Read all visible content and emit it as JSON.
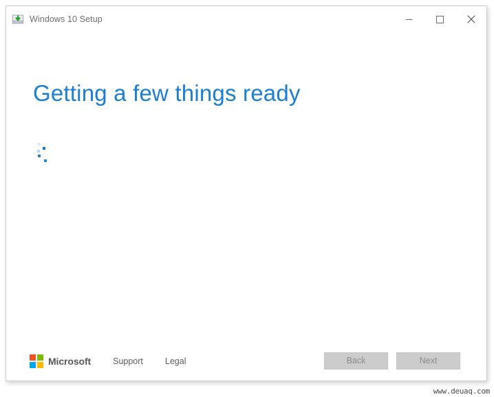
{
  "window": {
    "title": "Windows 10 Setup",
    "app_icon": "windows-setup-download-icon",
    "controls": {
      "minimize": "minimize-icon",
      "maximize": "maximize-icon",
      "close": "close-icon"
    }
  },
  "main": {
    "heading": "Getting a few things ready",
    "heading_color": "#1a7fd4",
    "spinner": {
      "name": "loading-spinner",
      "dot_color": "#1b79c8",
      "dot_count": 5
    }
  },
  "footer": {
    "brand": {
      "logo_name": "microsoft-logo",
      "wordmark": "Microsoft",
      "logo_colors": {
        "top_left": "#f25022",
        "top_right": "#7fba00",
        "bottom_left": "#00a4ef",
        "bottom_right": "#ffb900"
      }
    },
    "links": [
      {
        "label": "Support"
      },
      {
        "label": "Legal"
      }
    ],
    "buttons": [
      {
        "label": "Back",
        "name": "back-button",
        "disabled": true
      },
      {
        "label": "Next",
        "name": "next-button",
        "disabled": true
      }
    ]
  },
  "watermark": {
    "text": "www.deuaq.com"
  }
}
